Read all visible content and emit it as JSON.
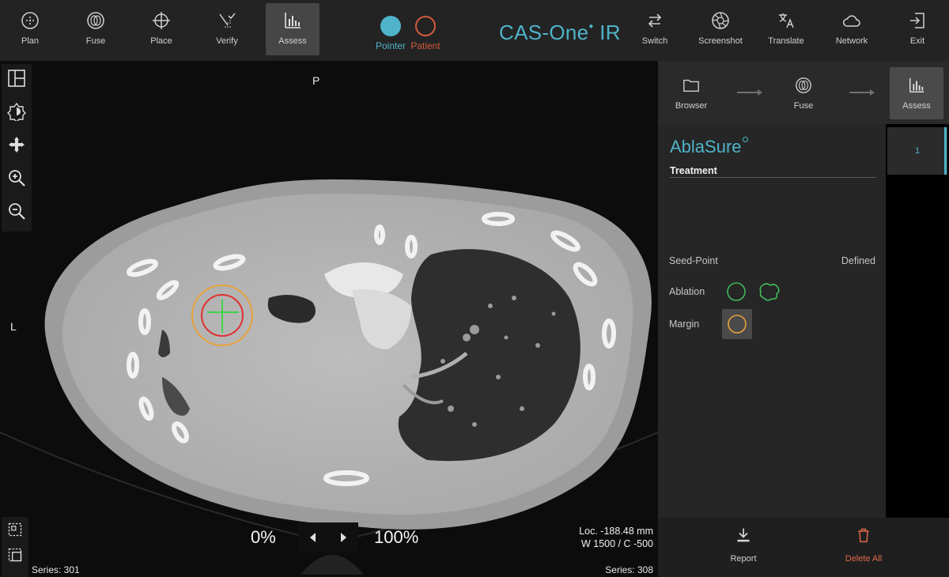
{
  "toolbar": {
    "items": [
      {
        "label": "Plan",
        "icon": "plan-icon"
      },
      {
        "label": "Fuse",
        "icon": "fuse-icon"
      },
      {
        "label": "Place",
        "icon": "crosshair-icon"
      },
      {
        "label": "Verify",
        "icon": "verify-icon"
      },
      {
        "label": "Assess",
        "icon": "bar-chart-icon",
        "active": true
      }
    ],
    "pointer_label": "Pointer",
    "patient_label": "Patient",
    "brand": "CAS-One",
    "brand_suffix": "IR",
    "right_items": [
      {
        "label": "Switch",
        "icon": "switch-icon"
      },
      {
        "label": "Screenshot",
        "icon": "shutter-icon"
      },
      {
        "label": "Translate",
        "icon": "translate-icon"
      },
      {
        "label": "Network",
        "icon": "cloud-icon"
      },
      {
        "label": "Exit",
        "icon": "exit-icon"
      }
    ],
    "colors": {
      "pointer": "#4fb3c9",
      "patient": "#d25a3c"
    }
  },
  "viewer": {
    "orient_top": "P",
    "orient_left": "L",
    "series_left": "Series: 301",
    "series_right": "Series: 308",
    "loc": "Loc. -188.48 mm",
    "window": "W 1500 / C -500",
    "blend_min": "0%",
    "blend_max": "100%"
  },
  "workflow": {
    "steps": [
      {
        "label": "Browser",
        "icon": "folder-icon"
      },
      {
        "label": "Fuse",
        "icon": "fuse-icon"
      },
      {
        "label": "Assess",
        "icon": "bar-chart-icon",
        "active": true
      }
    ]
  },
  "ablasure": {
    "title": "AblaSure",
    "section": "Treatment",
    "seed_label": "Seed-Point",
    "seed_value": "Defined",
    "ablation_label": "Ablation",
    "margin_label": "Margin",
    "colors": {
      "ablation": "#3fb85a",
      "margin": "#e7a23a",
      "target": "#e03030"
    }
  },
  "segments": {
    "items": [
      "1"
    ]
  },
  "bottom": {
    "report_label": "Report",
    "delete_label": "Delete All",
    "delete_color": "#e06a4a"
  }
}
